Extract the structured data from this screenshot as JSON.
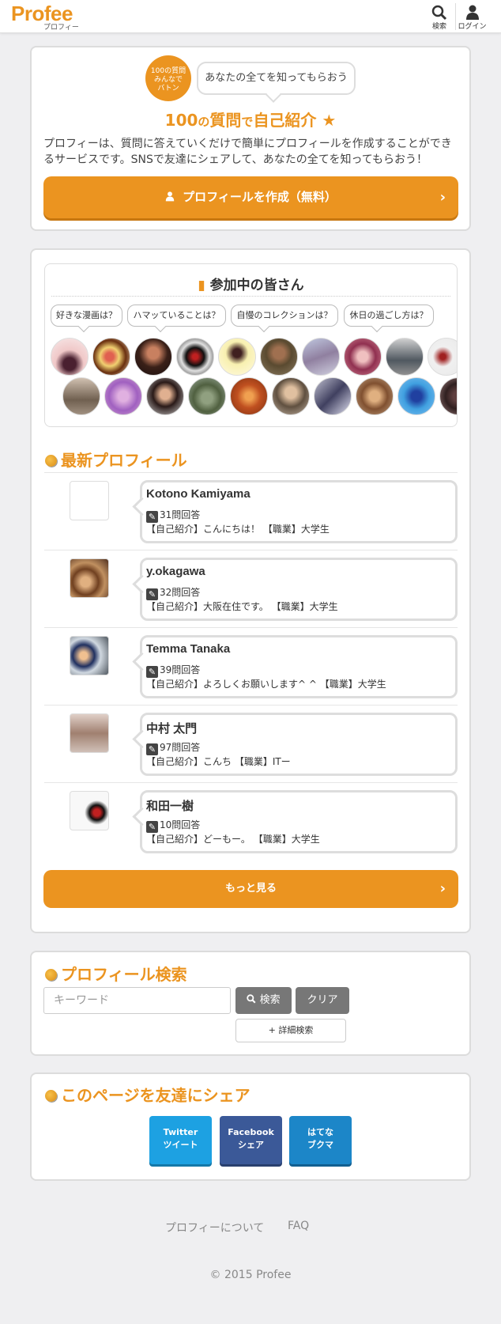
{
  "header": {
    "logo": "Profee",
    "logo_sub": "プロフィー",
    "search_label": "検索",
    "login_label": "ログイン"
  },
  "hero": {
    "badge_line1": "100の質問",
    "badge_line2": "みんなで",
    "badge_line3": "バトン",
    "bubble": "あなたの全てを知ってもらおう",
    "title_a": "100",
    "title_b": "の",
    "title_c": "質問",
    "title_d": "で",
    "title_e": "自己紹介",
    "title_star": "★",
    "desc": "プロフィーは、質問に答えていくだけで簡単にプロフィールを作成することができるサービスです。SNSで友達にシェアして、あなたの全てを知ってもらおう！",
    "create_button": "プロフィールを作成（無料）"
  },
  "participants": {
    "title": "参加中の皆さん",
    "questions": [
      "好きな漫画は？",
      "ハマッていることは？",
      "自慢のコレクションは？",
      "休日の過ごし方は？"
    ]
  },
  "latest": {
    "title": "最新プロフィール",
    "profiles": [
      {
        "name": "Kotono Kamiyama",
        "count": "31問回答",
        "intro": "【自己紹介】こんにちは！ 【職業】大学生"
      },
      {
        "name": "y.okagawa",
        "count": "32問回答",
        "intro": "【自己紹介】大阪在住です。 【職業】大学生"
      },
      {
        "name": "Temma Tanaka",
        "count": "39問回答",
        "intro": "【自己紹介】よろしくお願いします^ ^ 【職業】大学生"
      },
      {
        "name": "中村 太門",
        "count": "97問回答",
        "intro": "【自己紹介】こんち 【職業】ITー"
      },
      {
        "name": "和田一樹",
        "count": "10問回答",
        "intro": "【自己紹介】どーもー。 【職業】大学生"
      }
    ],
    "more_button": "もっと見る"
  },
  "search": {
    "title": "プロフィール検索",
    "placeholder": "キーワード",
    "search_button": "検索",
    "clear_button": "クリア",
    "detail_button": "+ 詳細検索"
  },
  "share": {
    "title": "このページを友達にシェア",
    "twitter_1": "Twitter",
    "twitter_2": "ツイート",
    "facebook_1": "Facebook",
    "facebook_2": "シェア",
    "hatena_1": "はてな",
    "hatena_2": "ブクマ"
  },
  "footer": {
    "about": "プロフィーについて",
    "faq": "FAQ",
    "copyright": "© 2015 Profee"
  },
  "colors": {
    "accent": "#eb9420",
    "twitter": "#1da1e2",
    "facebook": "#3b5998",
    "hatena": "#1c86c8"
  }
}
